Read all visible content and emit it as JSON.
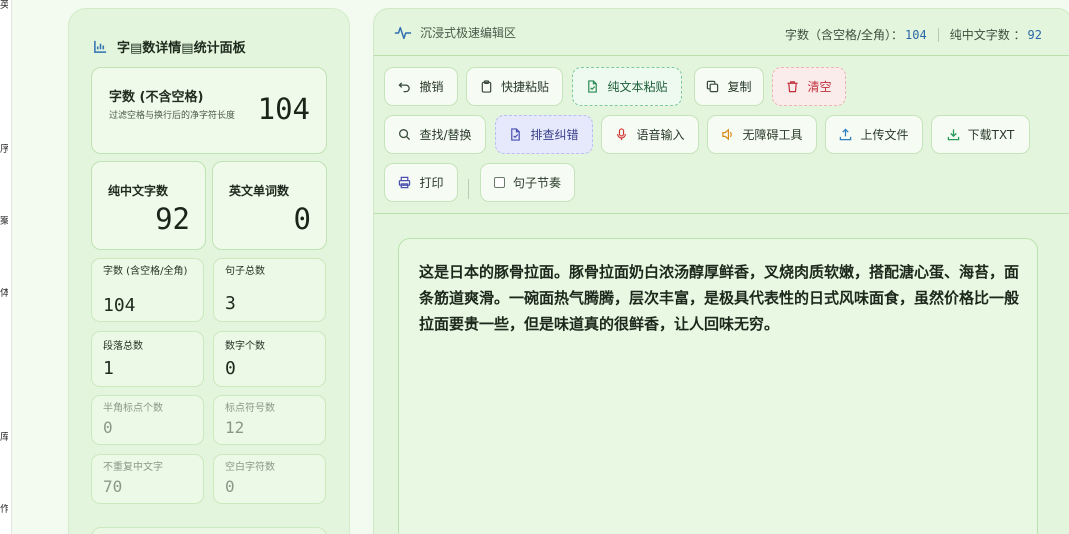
{
  "edge_chars": [
    "英",
    "序",
    "案",
    "体",
    "库",
    "作"
  ],
  "stats": {
    "title": "字▤数详情▤统计面板",
    "main_card": {
      "label": "字数 (不含空格)",
      "desc": "过滤空格与换行后的净字符长度",
      "value": "104"
    },
    "pure_chinese": {
      "label": "纯中文字数",
      "value": "92"
    },
    "english_words": {
      "label": "英文单词数",
      "value": "0"
    },
    "small_cards": [
      {
        "label": "字数 (含空格/全角)",
        "value": "104"
      },
      {
        "label": "句子总数",
        "value": "3"
      },
      {
        "label": "段落总数",
        "value": "1"
      },
      {
        "label": "数字个数",
        "value": "0"
      },
      {
        "label": "半角标点个数",
        "value": "0"
      },
      {
        "label": "标点符号数",
        "value": "12"
      },
      {
        "label": "不重复中文字",
        "value": "70"
      },
      {
        "label": "空白字符数",
        "value": "0"
      }
    ]
  },
  "editor": {
    "title": "沉浸式极速编辑区",
    "count_with_space_label": "字数（含空格/全角）：",
    "count_with_space_value": "104",
    "count_chinese_label": "纯中文字数 ：",
    "count_chinese_value": "92",
    "buttons": {
      "undo": "撤销",
      "quick_paste": "快捷粘贴",
      "plain_paste": "纯文本粘贴",
      "copy": "复制",
      "clear": "清空",
      "find_replace": "查找/替换",
      "proofread": "排查纠错",
      "voice_input": "语音输入",
      "accessibility": "无障碍工具",
      "upload": "上传文件",
      "download": "下载TXT",
      "print": "打印",
      "sentence_rhythm": "句子节奏"
    },
    "text": "这是日本的豚骨拉面。豚骨拉面奶白浓汤醇厚鲜香，叉烧肉质软嫩，搭配溏心蛋、海苔，面条筋道爽滑。一碗面热气腾腾，层次丰富，是极具代表性的日式风味面食，虽然价格比一般拉面要贵一些，但是味道真的很鲜香，让人回味无穷。"
  },
  "colors": {
    "accent_blue": "#2a68a8",
    "danger_red": "#c0303b",
    "panel_green": "#e3f5dc"
  }
}
